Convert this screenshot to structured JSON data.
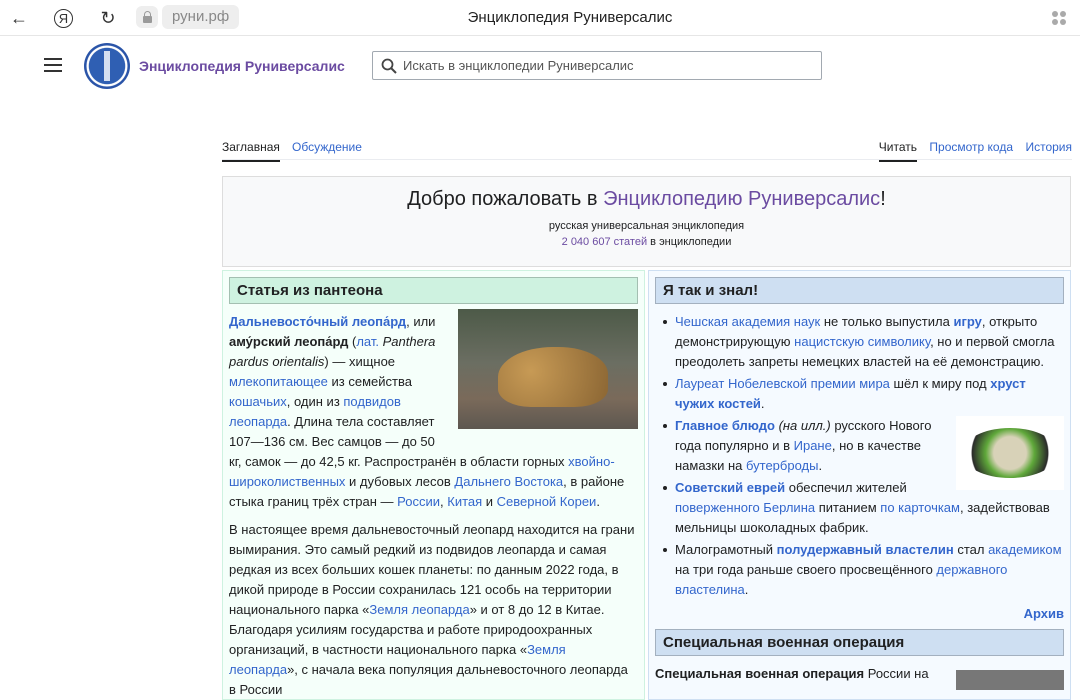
{
  "browser": {
    "url": "руни.рф",
    "title": "Энциклопедия Руниверсалис"
  },
  "header": {
    "site_name": "Энциклопедия Руниверсалис",
    "search_placeholder": "Искать в энциклопедии Руниверсалис"
  },
  "tabs": {
    "left": [
      "Заглавная",
      "Обсуждение"
    ],
    "right": [
      "Читать",
      "Просмотр кода",
      "История"
    ]
  },
  "welcome": {
    "prefix": "Добро пожаловать в ",
    "link": "Энциклопедию Руниверсалис",
    "suffix": "!",
    "subtitle": "русская универсальная энциклопедия",
    "count": "2 040 607 статей",
    "count_suffix": " в энциклопедии"
  },
  "pantheon": {
    "title": "Статья из пантеона",
    "p1": [
      {
        "t": "Дальневосто́чный леопа́рд",
        "l": 1,
        "b": 1
      },
      {
        "t": ", или "
      },
      {
        "t": "аму́рский леопа́рд",
        "b": 1
      },
      {
        "t": " ("
      },
      {
        "t": "лат.",
        "l": 1
      },
      {
        "t": " "
      },
      {
        "t": "Panthera pardus orientalis",
        "i": 1
      },
      {
        "t": ") — хищное "
      },
      {
        "t": "млекопитающее",
        "l": 1
      },
      {
        "t": " из семейства "
      },
      {
        "t": "кошачьих",
        "l": 1
      },
      {
        "t": ", один из "
      },
      {
        "t": "подвидов леопарда",
        "l": 1
      },
      {
        "t": ". Длина тела составляет 107—136 см. Вес самцов — до 50 кг, самок — до 42,5 кг. Распространён в области горных "
      },
      {
        "t": "хвойно-широколиственных",
        "l": 1
      },
      {
        "t": " и дубовых лесов "
      },
      {
        "t": "Дальнего Востока",
        "l": 1
      },
      {
        "t": ", в районе стыка границ трёх стран — "
      },
      {
        "t": "России",
        "l": 1
      },
      {
        "t": ", "
      },
      {
        "t": "Китая",
        "l": 1
      },
      {
        "t": " и "
      },
      {
        "t": "Северной Кореи",
        "l": 1
      },
      {
        "t": "."
      }
    ],
    "p2": [
      {
        "t": "В настоящее время дальневосточный леопард находится на грани вымирания. Это самый редкий из подвидов леопарда и самая редкая из всех больших кошек планеты: по данным 2022 года, в дикой природе в России сохранилась 121 особь на территории национального парка «"
      },
      {
        "t": "Земля леопарда",
        "l": 1
      },
      {
        "t": "» и от 8 до 12 в Китае. Благодаря усилиям государства и работе природоохранных организаций, в частности национального парка «"
      },
      {
        "t": "Земля леопарда",
        "l": 1
      },
      {
        "t": "», с начала века популяция дальневосточного леопарда в России"
      }
    ]
  },
  "dyk": {
    "title": "Я так и знал!",
    "items": [
      [
        {
          "t": "Чешская академия наук",
          "l": 1
        },
        {
          "t": " не только выпустила "
        },
        {
          "t": "игру",
          "l": 1,
          "b": 1
        },
        {
          "t": ", открыто демонстрирующую "
        },
        {
          "t": "нацистскую символику",
          "l": 1
        },
        {
          "t": ", но и первой смогла преодолеть запреты немецких властей на её демонстрацию."
        }
      ],
      [
        {
          "t": "Лауреат Нобелевской премии мира",
          "l": 1
        },
        {
          "t": " шёл к миру под "
        },
        {
          "t": "хруст чужих костей",
          "l": 1,
          "b": 1
        },
        {
          "t": "."
        }
      ],
      [
        {
          "t": "Главное блюдо",
          "l": 1,
          "b": 1
        },
        {
          "t": " "
        },
        {
          "t": "(на илл.)",
          "i": 1
        },
        {
          "t": " русского Нового года популярно и в "
        },
        {
          "t": "Иране",
          "l": 1
        },
        {
          "t": ", но в качестве намазки на "
        },
        {
          "t": "бутерброды",
          "l": 1
        },
        {
          "t": "."
        }
      ],
      [
        {
          "t": "Советский еврей",
          "l": 1,
          "b": 1
        },
        {
          "t": " обеспечил жителей "
        },
        {
          "t": "поверженного Берлина",
          "l": 1
        },
        {
          "t": " питанием "
        },
        {
          "t": "по карточкам",
          "l": 1
        },
        {
          "t": ", задействовав мельницы шоколадных фабрик."
        }
      ],
      [
        {
          "t": "Малограмотный "
        },
        {
          "t": "полудержавный властелин",
          "l": 1,
          "b": 1
        },
        {
          "t": " стал "
        },
        {
          "t": "академиком",
          "l": 1
        },
        {
          "t": " на три года раньше своего просвещённого "
        },
        {
          "t": "державного властелина",
          "l": 1
        },
        {
          "t": "."
        }
      ]
    ],
    "archive": "Архив"
  },
  "svo": {
    "title": "Специальная военная операция",
    "text": [
      {
        "t": "Специальная военная операция",
        "b": 1
      },
      {
        "t": " России на"
      }
    ]
  }
}
